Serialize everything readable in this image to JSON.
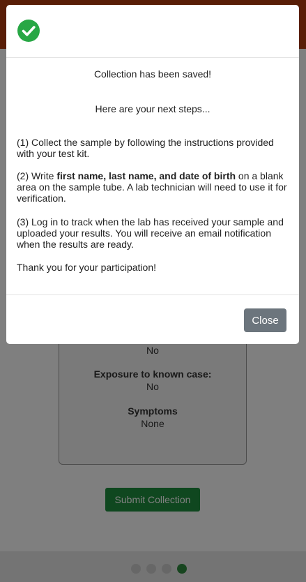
{
  "background": {
    "summary": {
      "top_value": "No",
      "fields": [
        {
          "label": "Exposure to known case:",
          "value": "No"
        },
        {
          "label": "Symptoms",
          "value": "None"
        }
      ]
    },
    "submit_label": "Submit Collection",
    "pager": {
      "total": 4,
      "active_index": 3
    }
  },
  "modal": {
    "icon": "check-circle-icon",
    "saved_message": "Collection has been saved!",
    "next_steps_heading": "Here are your next steps...",
    "step1": "(1) Collect the sample by following the instructions provided with your test kit.",
    "step2_prefix": "(2) Write ",
    "step2_bold": "first name, last name, and date of birth",
    "step2_suffix": " on a blank area on the sample tube. A lab technician will need to use it for verification.",
    "step3": "(3) Log in to track when the lab has received your sample and uploaded your results. You will receive an email notification when the results are ready.",
    "thanks": "Thank you for your participation!",
    "close_label": "Close"
  },
  "colors": {
    "header_accent": "#b23c0e",
    "success_green": "#28a745",
    "submit_green": "#1e8f3e",
    "close_gray": "#6c757d",
    "active_dot": "#2e8b3e"
  }
}
